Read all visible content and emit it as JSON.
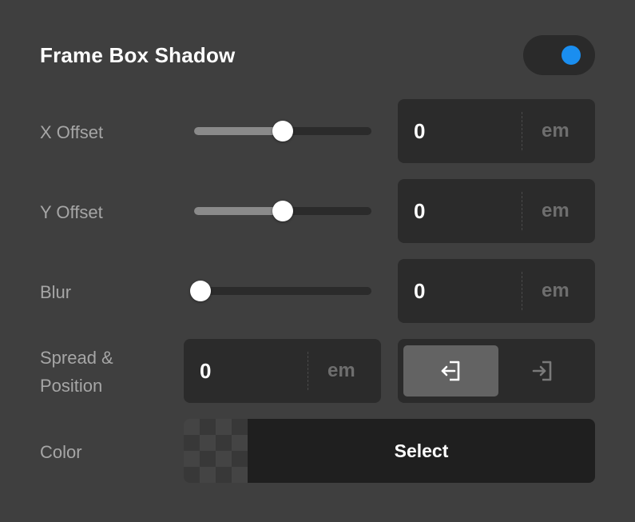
{
  "header": {
    "title": "Frame Box Shadow",
    "toggle_on": true,
    "toggle_color": "#1a8ef0"
  },
  "x_offset": {
    "label": "X Offset",
    "value": "0",
    "unit": "em",
    "slider_fraction": 0.5
  },
  "y_offset": {
    "label": "Y Offset",
    "value": "0",
    "unit": "em",
    "slider_fraction": 0.5
  },
  "blur": {
    "label": "Blur",
    "value": "0",
    "unit": "em",
    "slider_fraction": 0.0
  },
  "spread": {
    "label_line1": "Spread &",
    "label_line2": "Position",
    "value": "0",
    "unit": "em",
    "positions": [
      {
        "name": "outside",
        "icon": "arrow-out-of-box-icon",
        "active": true
      },
      {
        "name": "inside",
        "icon": "arrow-into-box-icon",
        "active": false
      }
    ]
  },
  "color": {
    "label": "Color",
    "select_label": "Select"
  }
}
